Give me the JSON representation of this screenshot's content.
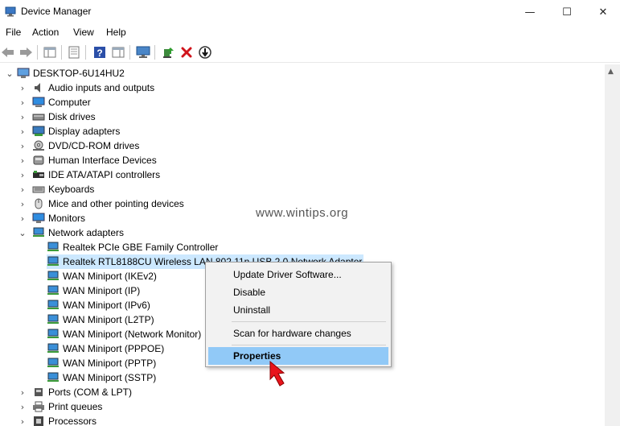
{
  "window": {
    "title": "Device Manager",
    "controls": {
      "minimize": "—",
      "maximize": "☐",
      "close": "✕"
    }
  },
  "menu": {
    "items": [
      "File",
      "Action",
      "View",
      "Help"
    ]
  },
  "tree": {
    "root": "DESKTOP-6U14HU2",
    "categories_before": [
      {
        "label": "Audio inputs and outputs",
        "icon": "speaker-icon"
      },
      {
        "label": "Computer",
        "icon": "computer-icon"
      },
      {
        "label": "Disk drives",
        "icon": "disk-drive-icon"
      },
      {
        "label": "Display adapters",
        "icon": "display-adapter-icon"
      },
      {
        "label": "DVD/CD-ROM drives",
        "icon": "dvd-drive-icon"
      },
      {
        "label": "Human Interface Devices",
        "icon": "hid-icon"
      },
      {
        "label": "IDE ATA/ATAPI controllers",
        "icon": "ide-controller-icon"
      },
      {
        "label": "Keyboards",
        "icon": "keyboard-icon"
      },
      {
        "label": "Mice and other pointing devices",
        "icon": "mouse-icon"
      },
      {
        "label": "Monitors",
        "icon": "monitor-icon"
      }
    ],
    "network_category": "Network adapters",
    "network_children": [
      "Realtek PCIe GBE Family Controller",
      "Realtek RTL8188CU Wireless LAN 802.11n USB 2.0 Network Adapter",
      "WAN Miniport (IKEv2)",
      "WAN Miniport (IP)",
      "WAN Miniport (IPv6)",
      "WAN Miniport (L2TP)",
      "WAN Miniport (Network Monitor)",
      "WAN Miniport (PPPOE)",
      "WAN Miniport (PPTP)",
      "WAN Miniport (SSTP)"
    ],
    "selected_index": 1,
    "categories_after": [
      {
        "label": "Ports (COM & LPT)",
        "icon": "port-icon"
      },
      {
        "label": "Print queues",
        "icon": "printer-icon"
      },
      {
        "label": "Processors",
        "icon": "processor-icon"
      }
    ]
  },
  "watermark": "www.wintips.org",
  "context_menu": {
    "update": "Update Driver Software...",
    "disable": "Disable",
    "uninstall": "Uninstall",
    "scan": "Scan for hardware changes",
    "properties": "Properties"
  },
  "colors": {
    "selection": "#cce8ff",
    "menu_highlight": "#91c9f7",
    "pointer_arrow": "#e8141c"
  }
}
